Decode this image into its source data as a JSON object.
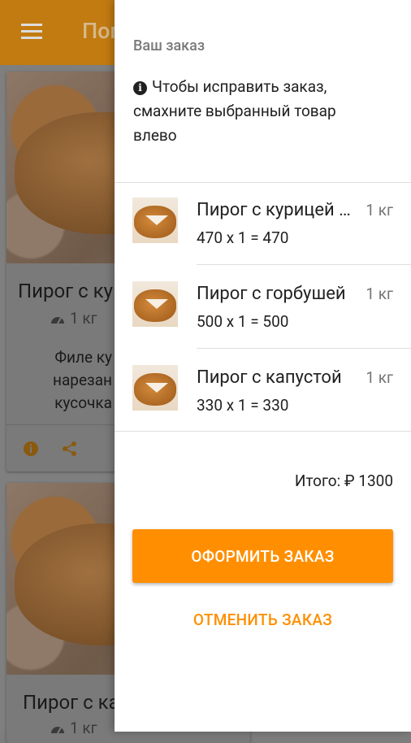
{
  "app_bar": {
    "title": "Пог"
  },
  "product_cards": [
    {
      "name": "Пирог с ку",
      "weight": "1 кг",
      "description_lines": [
        "Филе ку",
        "нарезан",
        "кусочка"
      ]
    },
    {
      "name": "Пирог с ка",
      "weight": "1 кг"
    }
  ],
  "drawer": {
    "title": "Ваш заказ",
    "hint": "Чтобы исправить заказ, смахните выбранный товар влево",
    "items": [
      {
        "name": "Пирог с курицей …",
        "weight": "1 кг",
        "calc": "470 x 1 = 470"
      },
      {
        "name": "Пирог с горбушей",
        "weight": "1 кг",
        "calc": "500 x 1 = 500"
      },
      {
        "name": "Пирог с капустой",
        "weight": "1 кг",
        "calc": "330 x 1 = 330"
      }
    ],
    "total": "Итого: ₽ 1300",
    "checkout_label": "ОФОРМИТЬ ЗАКАЗ",
    "cancel_label": "ОТМЕНИТЬ ЗАКАЗ"
  },
  "colors": {
    "accent": "#ff8f00",
    "app_bar": "#f39c12",
    "scrim": "rgba(0,0,0,0.5)"
  }
}
